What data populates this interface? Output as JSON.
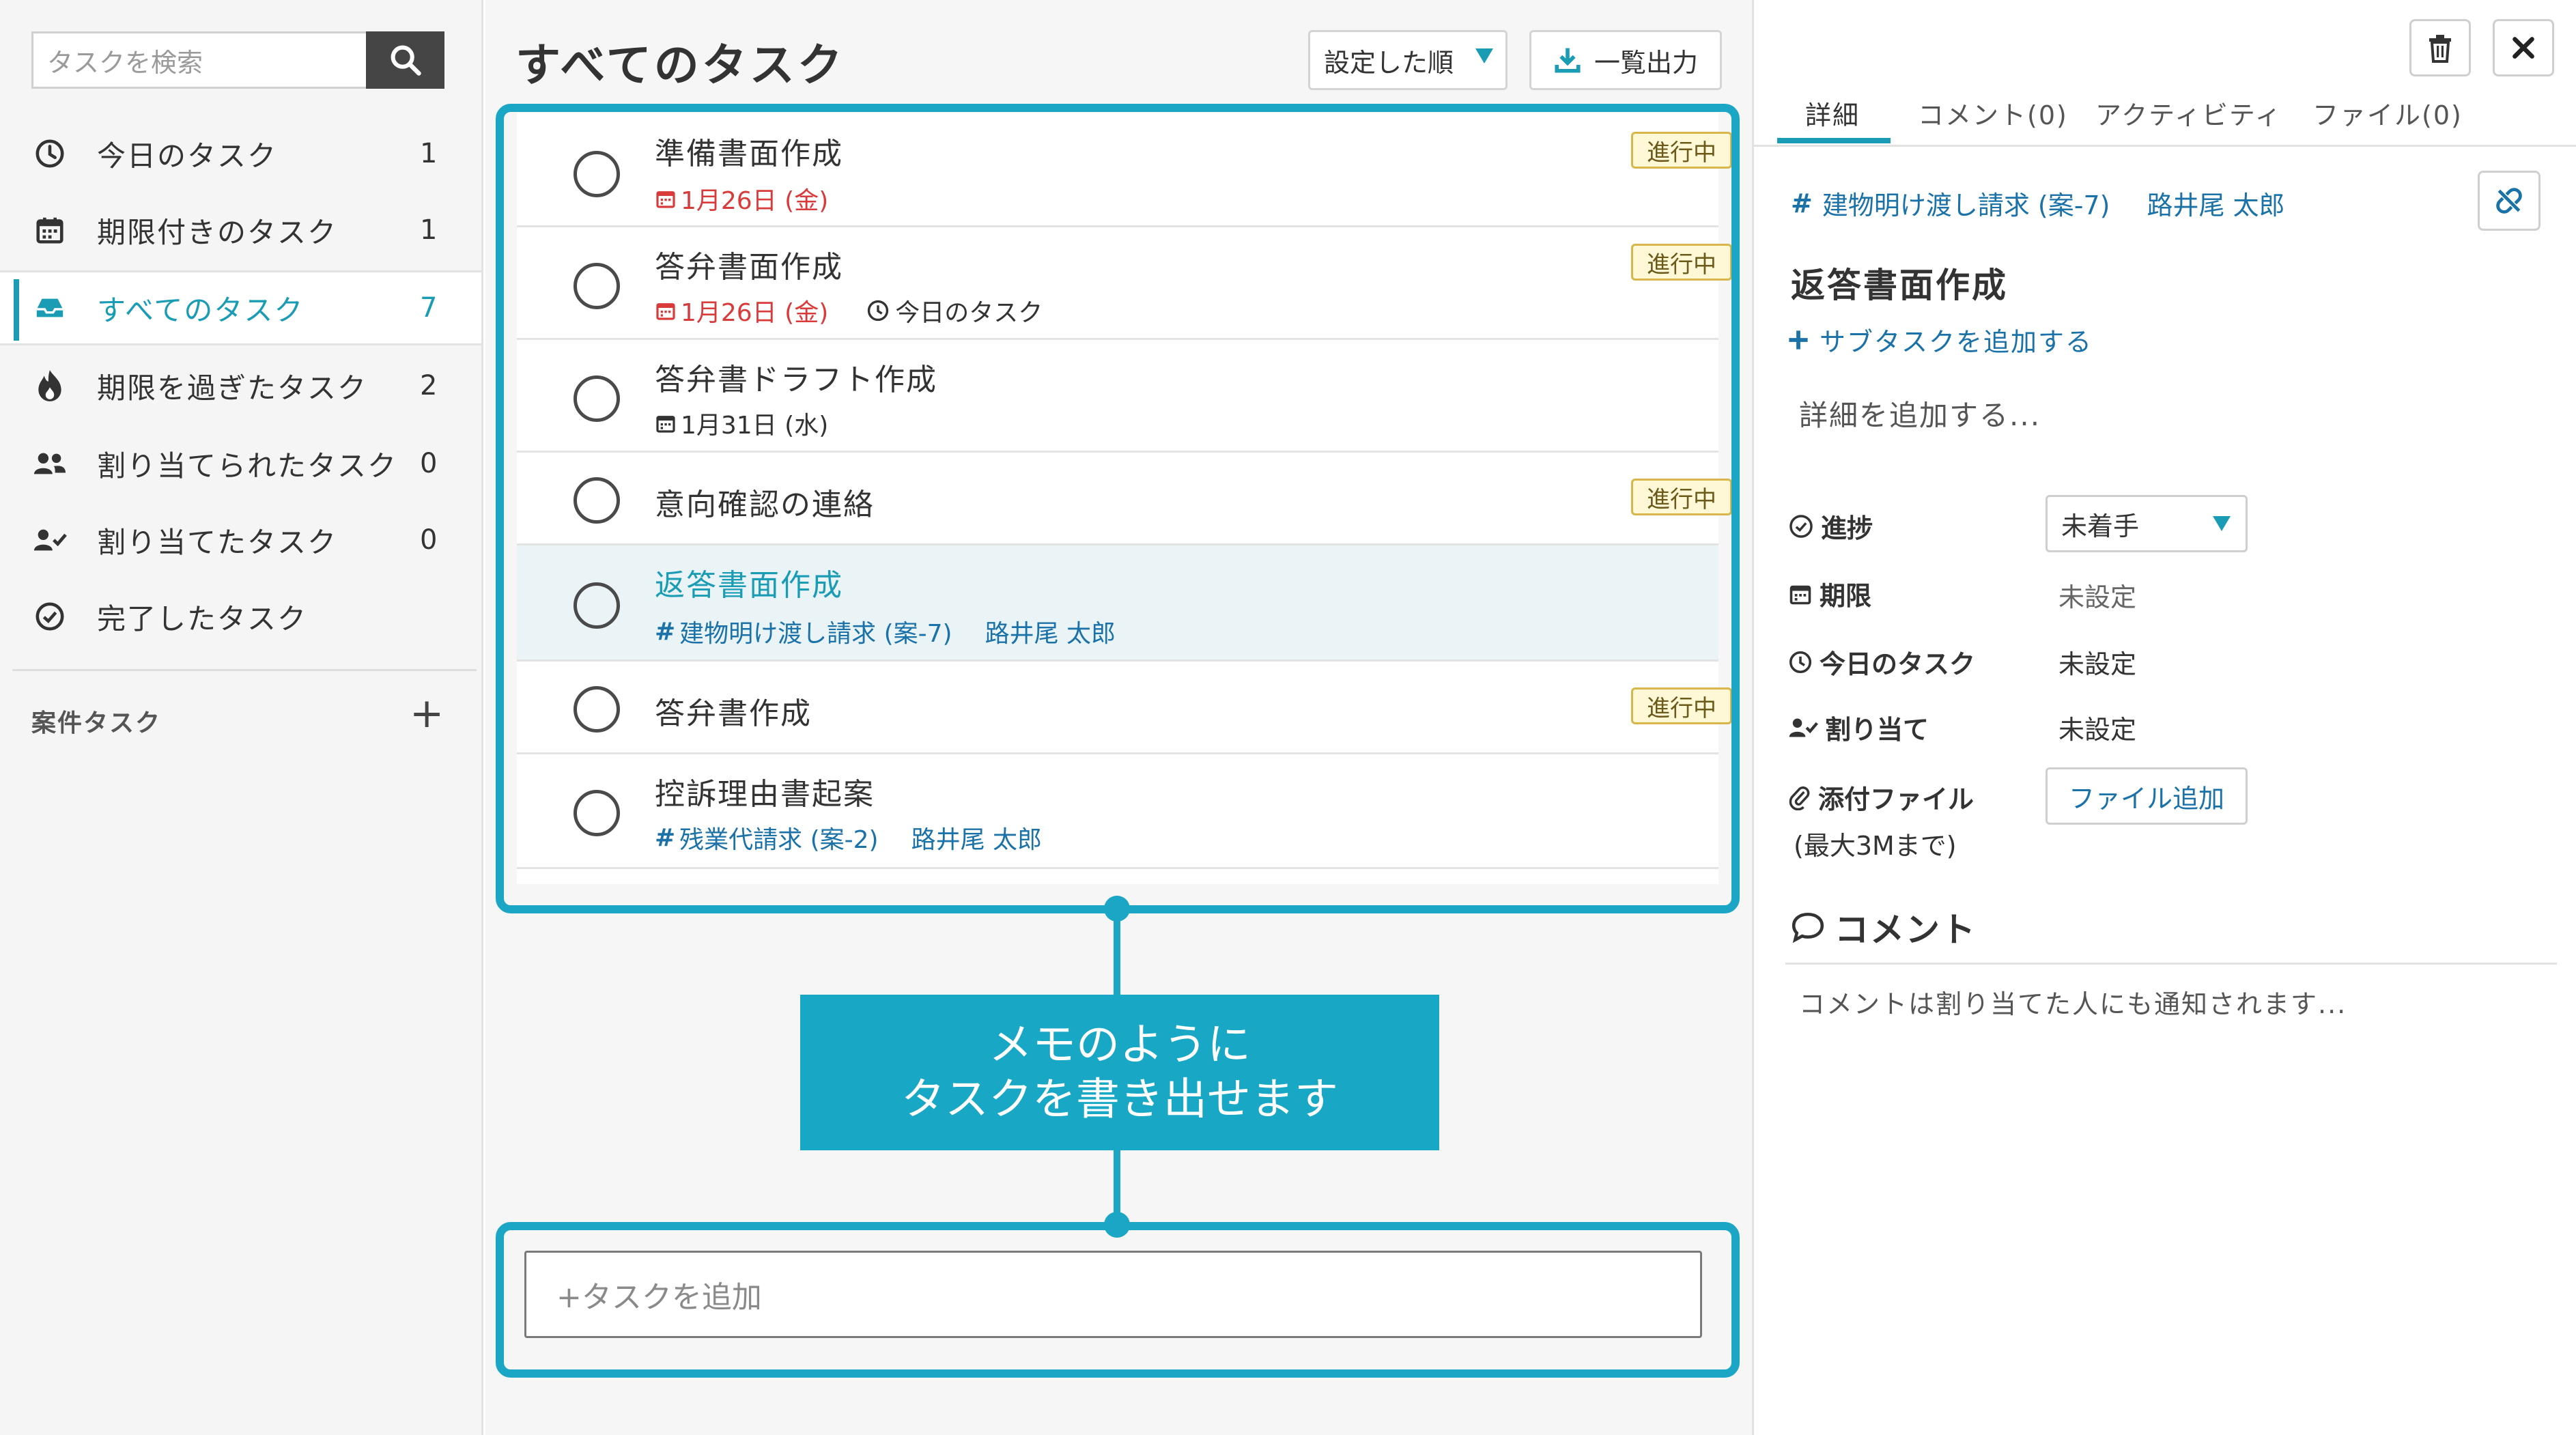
{
  "search": {
    "placeholder": "タスクを検索"
  },
  "sidebar": {
    "items": [
      {
        "label": "今日のタスク",
        "count": "1",
        "icon": "clock-icon"
      },
      {
        "label": "期限付きのタスク",
        "count": "1",
        "icon": "calendar-icon"
      },
      {
        "label": "すべてのタスク",
        "count": "7",
        "icon": "inbox-icon"
      },
      {
        "label": "期限を過ぎたタスク",
        "count": "2",
        "icon": "fire-icon"
      },
      {
        "label": "割り当てられたタスク",
        "count": "0",
        "icon": "users-icon"
      },
      {
        "label": "割り当てたタスク",
        "count": "0",
        "icon": "user-check-icon"
      },
      {
        "label": "完了したタスク",
        "count": "",
        "icon": "check-circle-icon"
      }
    ],
    "case_section": "案件タスク",
    "case_add": "+"
  },
  "main": {
    "title": "すべてのタスク",
    "sort_label": "設定した順",
    "export_label": "一覧出力",
    "tasks": [
      {
        "title": "準備書面作成",
        "due": "1月26日 (金)",
        "badge": "進行中"
      },
      {
        "title": "答弁書面作成",
        "due": "1月26日 (金)",
        "today": "今日のタスク",
        "badge": "進行中"
      },
      {
        "title": "答弁書ドラフト作成",
        "due": "1月31日 (水)"
      },
      {
        "title": "意向確認の連絡",
        "badge": "進行中"
      },
      {
        "title": "返答書面作成",
        "case": "建物明け渡し請求 (案-7)",
        "assignee": "路井尾 太郎"
      },
      {
        "title": "答弁書作成",
        "badge": "進行中"
      },
      {
        "title": "控訴理由書起案",
        "case": "残業代請求 (案-2)",
        "assignee": "路井尾 太郎"
      }
    ],
    "add_task_placeholder": "+タスクを追加"
  },
  "callout": {
    "line1": "メモのように",
    "line2": "タスクを書き出せます",
    "color": "#1aa6c4"
  },
  "detail": {
    "tabs": [
      "詳細",
      "コメント(0)",
      "アクティビティ",
      "ファイル(0)"
    ],
    "case_link": "建物明け渡し請求 (案-7)",
    "assignee": "路井尾 太郎",
    "title": "返答書面作成",
    "add_subtask": "サブタスクを追加する",
    "description_placeholder": "詳細を追加する...",
    "props": {
      "progress_label": "進捗",
      "progress_value": "未着手",
      "due_label": "期限",
      "due_value": "未設定",
      "today_label": "今日のタスク",
      "today_value": "未設定",
      "assign_label": "割り当て",
      "assign_value": "未設定",
      "attach_label": "添付ファイル",
      "attach_note": "(最大3Mまで)",
      "file_add": "ファイル追加"
    },
    "comment_heading": "コメント",
    "comment_placeholder": "コメントは割り当てた人にも通知されます..."
  },
  "colors": {
    "accent": "#1a9cb5",
    "overdue": "#d93b3b",
    "badge_bg": "#fff8d6"
  }
}
